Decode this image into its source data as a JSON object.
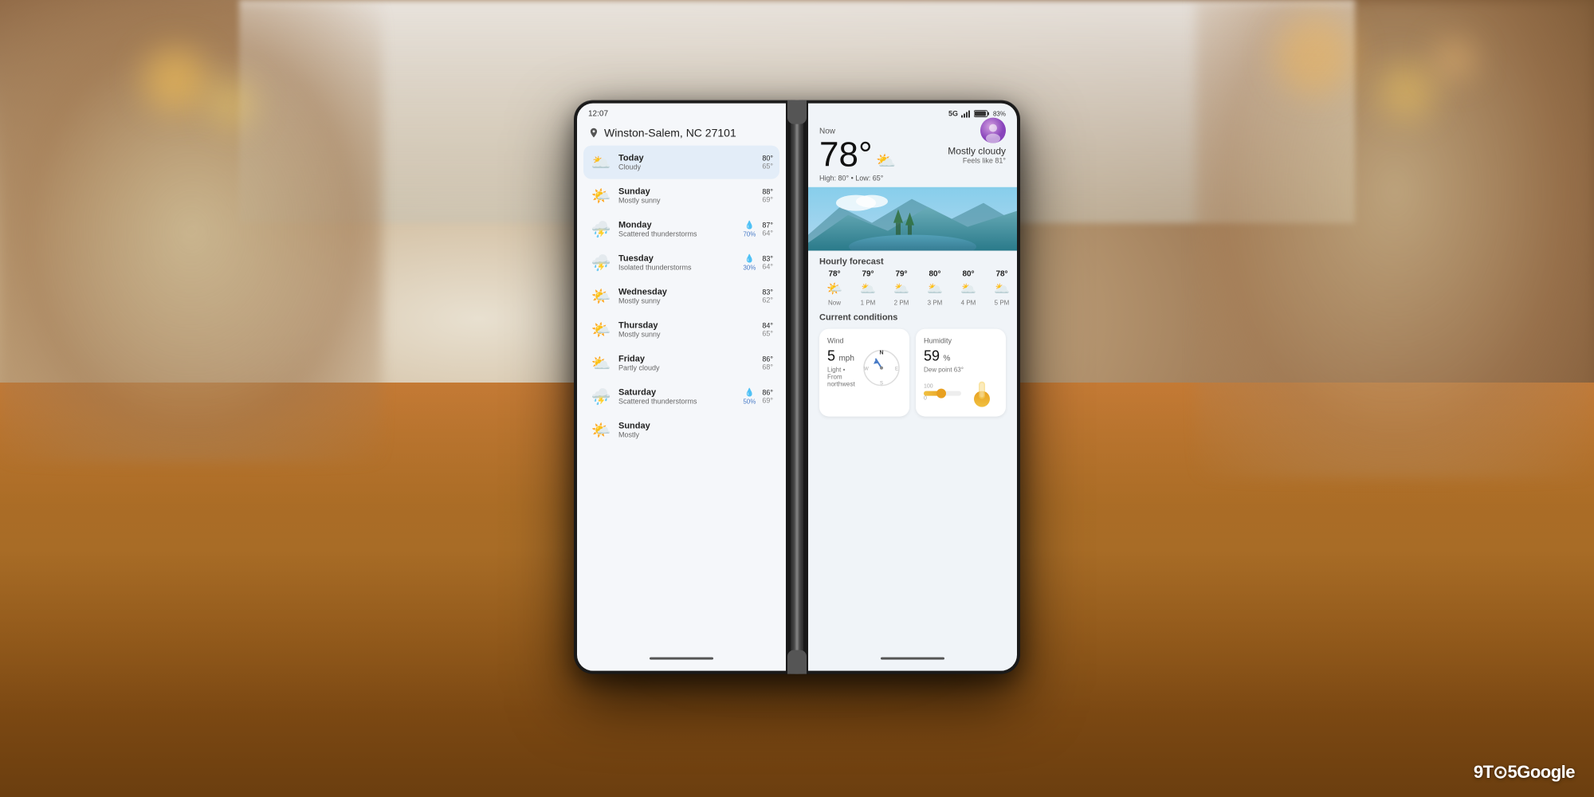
{
  "scene": {
    "watermark": "9TO5Google"
  },
  "phone": {
    "left_panel": {
      "status_time": "12:07",
      "location": "Winston-Salem, NC 27101",
      "weather_list": [
        {
          "day": "Today",
          "desc": "Cloudy",
          "icon": "🌥️",
          "high": "80°",
          "low": "65°",
          "selected": true,
          "precip": null
        },
        {
          "day": "Sunday",
          "desc": "Mostly sunny",
          "icon": "🌤️",
          "high": "88°",
          "low": "69°",
          "selected": false,
          "precip": null
        },
        {
          "day": "Monday",
          "desc": "Scattered thunderstorms",
          "icon": "⛈️",
          "high": "87°",
          "low": "64°",
          "selected": false,
          "precip": "70%"
        },
        {
          "day": "Tuesday",
          "desc": "Isolated thunderstorms",
          "icon": "⛈️",
          "high": "83°",
          "low": "64°",
          "selected": false,
          "precip": "30%"
        },
        {
          "day": "Wednesday",
          "desc": "Mostly sunny",
          "icon": "🌤️",
          "high": "83°",
          "low": "62°",
          "selected": false,
          "precip": null
        },
        {
          "day": "Thursday",
          "desc": "Mostly sunny",
          "icon": "🌤️",
          "high": "84°",
          "low": "65°",
          "selected": false,
          "precip": null
        },
        {
          "day": "Friday",
          "desc": "Partly cloudy",
          "icon": "⛅",
          "high": "86°",
          "low": "68°",
          "selected": false,
          "precip": null
        },
        {
          "day": "Saturday",
          "desc": "Scattered thunderstorms",
          "icon": "⛈️",
          "high": "86°",
          "low": "69°",
          "selected": false,
          "precip": "50%"
        },
        {
          "day": "Sunday",
          "desc": "Mostly",
          "icon": "🌤️",
          "high": "",
          "low": "",
          "selected": false,
          "precip": null
        }
      ]
    },
    "right_panel": {
      "status_5g": "5G",
      "status_signal": "▲",
      "status_battery": "83%",
      "now_label": "Now",
      "current_temp": "78°",
      "condition": "Mostly cloudy",
      "feels_like": "Feels like 81°",
      "high_low": "High: 80° • Low: 65°",
      "hourly_section": "Hourly forecast",
      "hourly": [
        {
          "temp": "78°",
          "icon": "🌤️",
          "time": "Now"
        },
        {
          "temp": "79°",
          "icon": "🌥️",
          "time": "1 PM"
        },
        {
          "temp": "79°",
          "icon": "🌥️",
          "time": "2 PM"
        },
        {
          "temp": "80°",
          "icon": "🌥️",
          "time": "3 PM"
        },
        {
          "temp": "80°",
          "icon": "🌥️",
          "time": "4 PM"
        },
        {
          "temp": "78°",
          "icon": "🌥️",
          "time": "5 PM"
        }
      ],
      "conditions_section": "Current conditions",
      "wind": {
        "title": "Wind",
        "speed": "5",
        "unit": "mph",
        "desc": "Light • From northwest",
        "direction": "N"
      },
      "humidity": {
        "title": "Humidity",
        "value": "59",
        "unit": "%",
        "dew_point": "Dew point 63°",
        "bar_max": "100",
        "bar_min": "0",
        "bar_value": 59
      }
    }
  }
}
